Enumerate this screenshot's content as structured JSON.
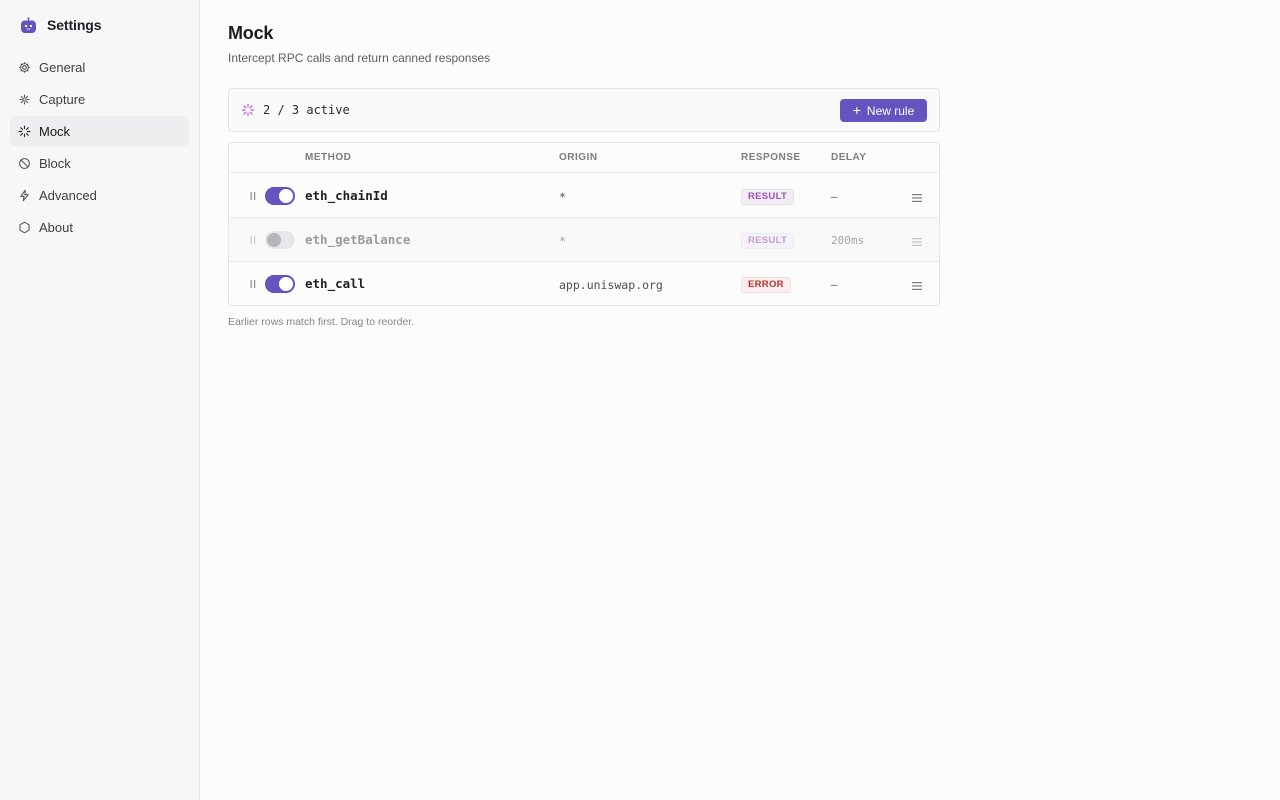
{
  "app": {
    "title": "Settings",
    "logo_icon": "robot-logo-icon",
    "accent_color": "#6554c0"
  },
  "sidebar": {
    "items": [
      {
        "label": "General",
        "icon": "gear-icon",
        "active": false
      },
      {
        "label": "Capture",
        "icon": "capture-icon",
        "active": false
      },
      {
        "label": "Mock",
        "icon": "spinner-icon",
        "active": true
      },
      {
        "label": "Block",
        "icon": "block-icon",
        "active": false
      },
      {
        "label": "Advanced",
        "icon": "lightning-icon",
        "active": false
      },
      {
        "label": "About",
        "icon": "hexagon-icon",
        "active": false
      }
    ]
  },
  "page": {
    "title": "Mock",
    "subtitle": "Intercept RPC calls and return canned responses"
  },
  "summary": {
    "active_text": "2 / 3 active",
    "new_rule_label": "New rule"
  },
  "table": {
    "columns": {
      "method": "METHOD",
      "origin": "ORIGIN",
      "response": "RESPONSE",
      "delay": "DELAY"
    },
    "rows": [
      {
        "enabled": true,
        "method": "eth_chainId",
        "origin": "*",
        "response": "RESULT",
        "response_kind": "result",
        "delay": "—"
      },
      {
        "enabled": false,
        "method": "eth_getBalance",
        "origin": "*",
        "response": "RESULT",
        "response_kind": "result",
        "delay": "200ms"
      },
      {
        "enabled": true,
        "method": "eth_call",
        "origin": "app.uniswap.org",
        "response": "ERROR",
        "response_kind": "error",
        "delay": "—"
      }
    ]
  },
  "footnote": "Earlier rows match first. Drag to reorder."
}
